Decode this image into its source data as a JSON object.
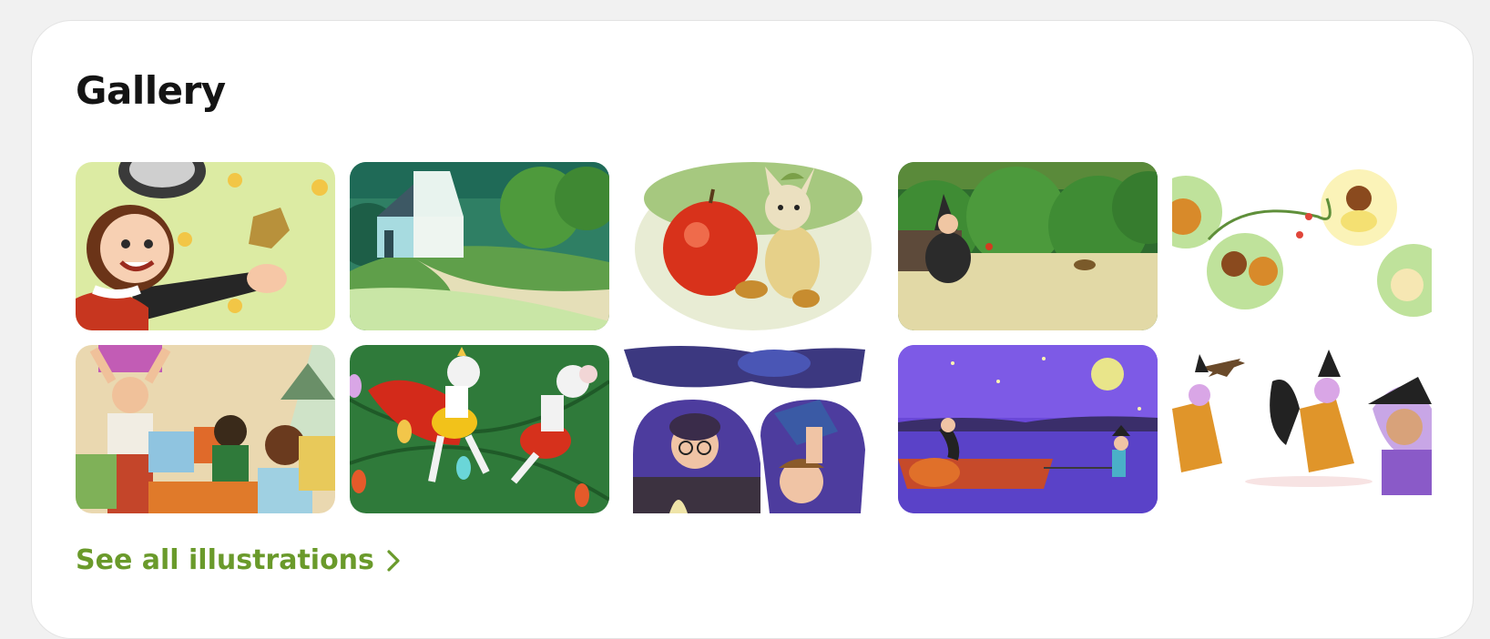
{
  "gallery": {
    "title": "Gallery",
    "see_all_label": "See all illustrations",
    "accent_color": "#6a9a2b",
    "illustrations": [
      {
        "subject": "smiling girl in red dress reaching out on a green meadow with flowers"
      },
      {
        "subject": "white cottage on a hill with a winding path and trees"
      },
      {
        "subject": "small cat-like creature holding a bitten red apple"
      },
      {
        "subject": "girl in a witch hat sitting by a forest edge"
      },
      {
        "subject": "round vignettes of a child and squirrels with flowers"
      },
      {
        "subject": "children opening presents beside a christmas tree"
      },
      {
        "subject": "two mice dancing among string lights on green"
      },
      {
        "subject": "children peeking from under a dark blue blanket"
      },
      {
        "subject": "witch towing a small boat under a full moon at night"
      },
      {
        "subject": "witches and a black cat jumping with a bird above"
      }
    ]
  }
}
